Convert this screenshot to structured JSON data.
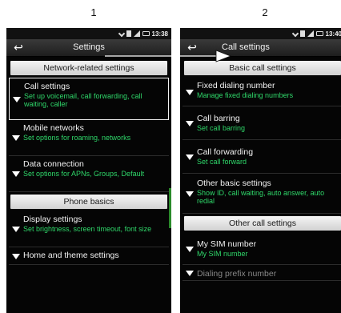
{
  "step_labels": [
    "1",
    "2"
  ],
  "left_screen": {
    "status_time": "13:38",
    "title": "Settings",
    "sections": [
      "Network-related settings",
      "Phone basics"
    ],
    "items": [
      {
        "title": "Call settings",
        "subtitle": "Set up voicemail, call forwarding, call waiting, caller"
      },
      {
        "title": "Mobile networks",
        "subtitle": "Set options for roaming, networks"
      },
      {
        "title": "Data connection",
        "subtitle": "Set options for APNs, Groups, Default"
      },
      {
        "title": "Display settings",
        "subtitle": "Set brightness, screen timeout, font size"
      },
      {
        "title": "Home and theme settings",
        "subtitle": ""
      }
    ]
  },
  "right_screen": {
    "status_time": "13:40",
    "title": "Call settings",
    "sections": [
      "Basic call settings",
      "Other call settings"
    ],
    "items": [
      {
        "title": "Fixed dialing number",
        "subtitle": "Manage fixed dialing numbers"
      },
      {
        "title": "Call barring",
        "subtitle": "Set call barring"
      },
      {
        "title": "Call forwarding",
        "subtitle": "Set call forward"
      },
      {
        "title": "Other basic settings",
        "subtitle": "Show ID, call waiting, auto answer, auto redial"
      },
      {
        "title": "My SIM number",
        "subtitle": "My SIM number"
      },
      {
        "title": "Dialing prefix number",
        "subtitle": ""
      }
    ]
  },
  "colors": {
    "subtitle": "#2fd86a",
    "background": "#050505"
  }
}
